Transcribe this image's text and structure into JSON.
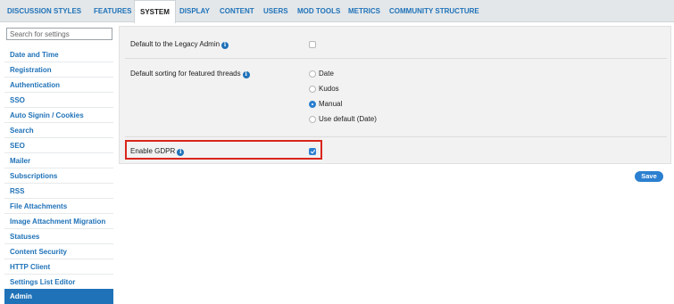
{
  "top_nav": {
    "tabs": [
      {
        "label": "DISCUSSION STYLES"
      },
      {
        "label": "FEATURES"
      },
      {
        "label": "SYSTEM",
        "active": true
      },
      {
        "label": "DISPLAY"
      },
      {
        "label": "CONTENT"
      },
      {
        "label": "USERS"
      },
      {
        "label": "MOD TOOLS"
      },
      {
        "label": "METRICS"
      },
      {
        "label": "COMMUNITY STRUCTURE"
      }
    ]
  },
  "sidebar": {
    "search_placeholder": "Search for settings",
    "items": [
      {
        "label": "Date and Time"
      },
      {
        "label": "Registration"
      },
      {
        "label": "Authentication"
      },
      {
        "label": "SSO"
      },
      {
        "label": "Auto Signin / Cookies"
      },
      {
        "label": "Search"
      },
      {
        "label": "SEO"
      },
      {
        "label": "Mailer"
      },
      {
        "label": "Subscriptions"
      },
      {
        "label": "RSS"
      },
      {
        "label": "File Attachments"
      },
      {
        "label": "Image Attachment Migration"
      },
      {
        "label": "Statuses"
      },
      {
        "label": "Content Security"
      },
      {
        "label": "HTTP Client"
      },
      {
        "label": "Settings List Editor"
      },
      {
        "label": "Admin",
        "active": true
      }
    ]
  },
  "settings": {
    "legacy_admin": {
      "label": "Default to the Legacy Admin",
      "checked": false
    },
    "featured_sorting": {
      "label": "Default sorting for featured threads",
      "options": [
        {
          "label": "Date",
          "selected": false
        },
        {
          "label": "Kudos",
          "selected": false
        },
        {
          "label": "Manual",
          "selected": true
        },
        {
          "label": "Use default (Date)",
          "selected": false
        }
      ]
    },
    "gdpr": {
      "label": "Enable GDPR",
      "checked": true
    }
  },
  "info_icon_glyph": "i",
  "save_label": "Save",
  "colors": {
    "accent": "#1f72b8",
    "highlight_border": "#d9261c",
    "panel_bg": "#f2f2f2",
    "nav_bg": "#e3e7ea"
  }
}
